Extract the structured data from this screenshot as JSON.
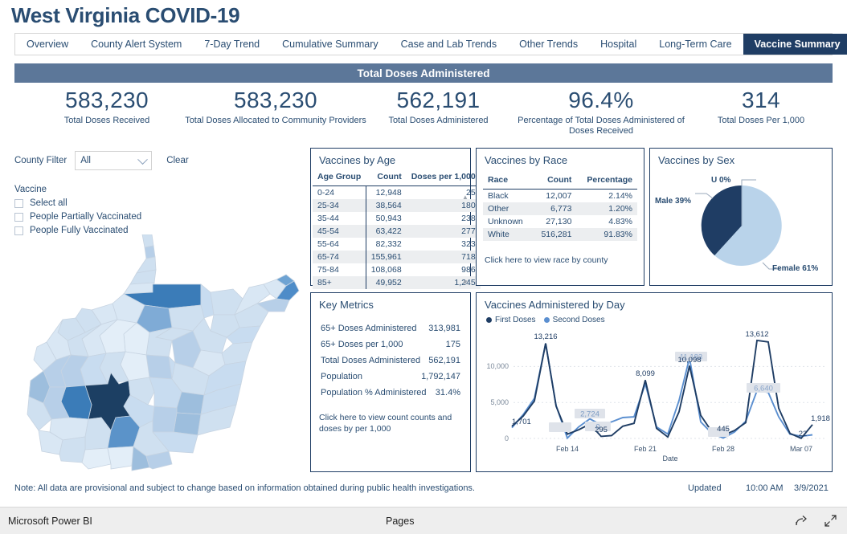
{
  "app": {
    "title": "West Virginia COVID-19",
    "banner": "Total Doses Administered",
    "note": "Note: All data are provisional and subject to change based on information obtained during public health investigations.",
    "updated_label": "Updated",
    "updated_time": "10:00 AM",
    "updated_date": "3/9/2021"
  },
  "colors": {
    "navy": "#1f3d64",
    "text_blue": "#2a4d72",
    "banner_blue": "#5c7799",
    "series_first": "#1f3d64",
    "series_second": "#5b8fd0",
    "pie_female": "#b9d3ea",
    "pie_male": "#1f3d64"
  },
  "tabs": [
    {
      "label": "Overview",
      "active": false
    },
    {
      "label": "County Alert System",
      "active": false
    },
    {
      "label": "7-Day Trend",
      "active": false
    },
    {
      "label": "Cumulative Summary",
      "active": false
    },
    {
      "label": "Case and Lab Trends",
      "active": false
    },
    {
      "label": "Other Trends",
      "active": false
    },
    {
      "label": "Hospital",
      "active": false
    },
    {
      "label": "Long-Term Care",
      "active": false
    },
    {
      "label": "Vaccine Summary",
      "active": true
    }
  ],
  "kpis": [
    {
      "value": "583,230",
      "label": "Total Doses Received"
    },
    {
      "value": "583,230",
      "label": "Total Doses Allocated to Community Providers"
    },
    {
      "value": "562,191",
      "label": "Total Doses Administered"
    },
    {
      "value": "96.4%",
      "label": "Percentage of Total Doses Administered of Doses Received"
    },
    {
      "value": "314",
      "label": "Total Doses Per 1,000"
    }
  ],
  "filters": {
    "county_label": "County Filter",
    "county_value": "All",
    "clear_label": "Clear",
    "vaccine_label": "Vaccine",
    "options": [
      "Select all",
      "People Partially Vaccinated",
      "People Fully Vaccinated"
    ]
  },
  "vaccines_by_age": {
    "title": "Vaccines by Age",
    "columns": [
      "Age Group",
      "Count",
      "Doses per 1,000"
    ],
    "rows": [
      [
        "0-24",
        "12,948",
        "25"
      ],
      [
        "25-34",
        "38,564",
        "180"
      ],
      [
        "35-44",
        "50,943",
        "238"
      ],
      [
        "45-54",
        "63,422",
        "277"
      ],
      [
        "55-64",
        "82,332",
        "323"
      ],
      [
        "65-74",
        "155,961",
        "718"
      ],
      [
        "75-84",
        "108,068",
        "986"
      ],
      [
        "85+",
        "49,952",
        "1,245"
      ]
    ]
  },
  "vaccines_by_race": {
    "title": "Vaccines by Race",
    "columns": [
      "Race",
      "Count",
      "Percentage"
    ],
    "rows": [
      [
        "Black",
        "12,007",
        "2.14%"
      ],
      [
        "Other",
        "6,773",
        "1.20%"
      ],
      [
        "Unknown",
        "27,130",
        "4.83%"
      ],
      [
        "White",
        "516,281",
        "91.83%"
      ]
    ],
    "link": "Click here to view race by county"
  },
  "vaccines_by_sex": {
    "title": "Vaccines by Sex",
    "labels": {
      "male": "Male 39%",
      "female": "Female 61%",
      "unknown": "U 0%"
    },
    "chart_data": {
      "type": "pie",
      "title": "Vaccines by Sex",
      "categories": [
        "Female",
        "Male",
        "U"
      ],
      "values": [
        61,
        39,
        0
      ],
      "legend": "labels"
    }
  },
  "key_metrics": {
    "title": "Key Metrics",
    "rows": [
      {
        "k": "65+ Doses Administered",
        "v": "313,981"
      },
      {
        "k": "65+ Doses per 1,000",
        "v": "175"
      },
      {
        "k": "Total Doses Administered",
        "v": "562,191"
      },
      {
        "k": "Population",
        "v": "1,792,147"
      },
      {
        "k": "Population % Administered",
        "v": "31.4%"
      }
    ],
    "link": "Click here to view count counts and doses by per 1,000"
  },
  "line_chart": {
    "title": "Vaccines Administered by Day",
    "legend": [
      "First Doses",
      "Second Doses"
    ],
    "xlabel": "Date",
    "chart_data": {
      "type": "line",
      "title": "Vaccines Administered by Day",
      "xlabel": "Date",
      "ylabel": "",
      "ylim": [
        0,
        14000
      ],
      "yticks": [
        "0",
        "5,000",
        "10,000"
      ],
      "xticks": [
        "Feb 14",
        "Feb 21",
        "Feb 28",
        "Mar 07"
      ],
      "x": [
        "Feb 09",
        "Feb 10",
        "Feb 11",
        "Feb 12",
        "Feb 13",
        "Feb 14",
        "Feb 15",
        "Feb 16",
        "Feb 17",
        "Feb 18",
        "Feb 19",
        "Feb 20",
        "Feb 21",
        "Feb 22",
        "Feb 23",
        "Feb 24",
        "Feb 25",
        "Feb 26",
        "Feb 27",
        "Feb 28",
        "Mar 01",
        "Mar 02",
        "Mar 03",
        "Mar 04",
        "Mar 05",
        "Mar 06",
        "Mar 07",
        "Mar 08"
      ],
      "series": [
        {
          "name": "First Doses",
          "color": "#1f3d64",
          "values": [
            1701,
            3100,
            5200,
            13216,
            4500,
            600,
            1200,
            2000,
            295,
            390,
            1700,
            2100,
            8099,
            1400,
            200,
            3700,
            10098,
            3200,
            900,
            445,
            1100,
            2200,
            13612,
            13400,
            4200,
            700,
            22,
            1918
          ]
        },
        {
          "name": "Second Doses",
          "color": "#5b8fd0",
          "values": [
            1500,
            3300,
            5600,
            13216,
            4700,
            50,
            1600,
            2724,
            1900,
            2300,
            2900,
            3000,
            7600,
            1600,
            600,
            5300,
            11183,
            2300,
            700,
            60,
            900,
            2400,
            6640,
            6400,
            3000,
            600,
            300,
            500
          ]
        }
      ],
      "labels": [
        {
          "text": "1,701",
          "series": "First Doses",
          "x": "Feb 09"
        },
        {
          "text": "13,216",
          "series": "Second Doses",
          "x": "Feb 12"
        },
        {
          "text": "2,724",
          "series": "Second Doses",
          "x": "Feb 16"
        },
        {
          "text": "295",
          "series": "First Doses",
          "x": "Feb 17"
        },
        {
          "text": "8,099",
          "series": "First Doses",
          "x": "Feb 21"
        },
        {
          "text": "11,183",
          "series": "Second Doses",
          "x": "Feb 25"
        },
        {
          "text": "10,098",
          "series": "First Doses",
          "x": "Feb 25"
        },
        {
          "text": "445",
          "series": "First Doses",
          "x": "Feb 28"
        },
        {
          "text": "13,612",
          "series": "First Doses",
          "x": "Mar 03"
        },
        {
          "text": "6,640",
          "series": "Second Doses",
          "x": "Mar 03"
        },
        {
          "text": "1,918",
          "series": "First Doses",
          "x": "Mar 08"
        },
        {
          "text": "22",
          "series": "First Doses",
          "x": "Mar 07"
        }
      ]
    }
  },
  "statusbar": {
    "brand": "Microsoft Power BI",
    "pages": "Pages"
  }
}
